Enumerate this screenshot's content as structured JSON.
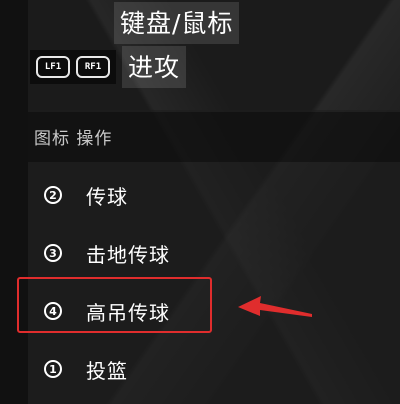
{
  "header": {
    "title": "键盘/鼠标"
  },
  "mode": {
    "keys": [
      {
        "label": "LF1"
      },
      {
        "label": "RF1"
      }
    ],
    "label": "进攻"
  },
  "list": {
    "header": "图标 操作",
    "items": [
      {
        "number": "2",
        "icon": "circled-2-icon",
        "label": "传球"
      },
      {
        "number": "3",
        "icon": "circled-3-icon",
        "label": "击地传球"
      },
      {
        "number": "4",
        "icon": "circled-4-icon",
        "label": "高吊传球",
        "highlighted": true
      },
      {
        "number": "1",
        "icon": "circled-1-icon",
        "label": "投篮"
      }
    ]
  },
  "annotation": {
    "color": "#e02d2d",
    "arrow": "left-arrow-icon"
  }
}
